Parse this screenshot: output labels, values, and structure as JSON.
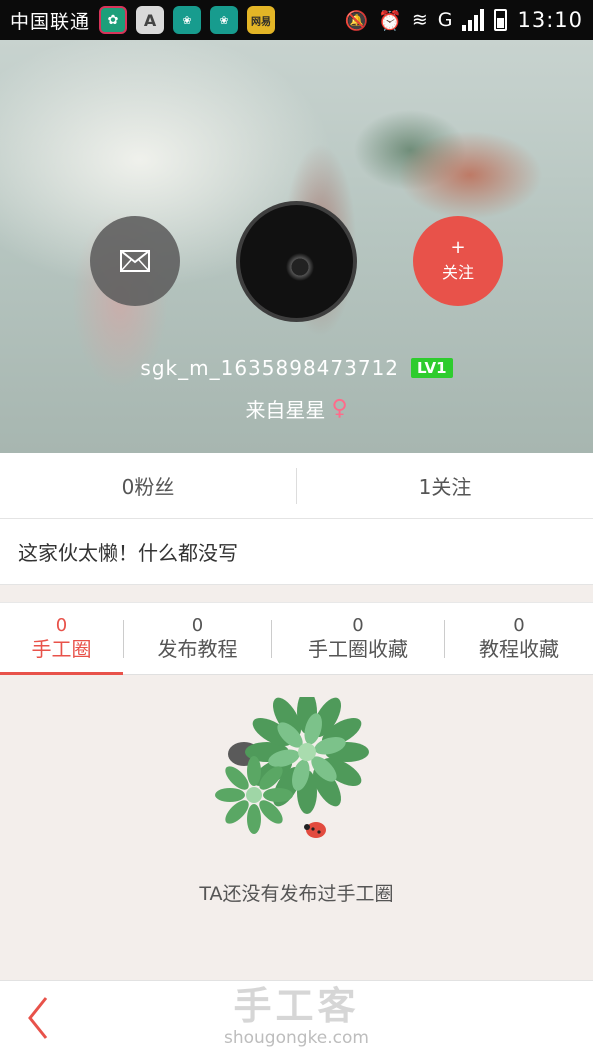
{
  "status_bar": {
    "carrier": "中国联通",
    "apps": [
      "A",
      "",
      "",
      "网易"
    ],
    "network": "G",
    "time": "13:10"
  },
  "profile": {
    "username": "sgk_m_1635898473712",
    "level": "LV1",
    "location": "来自星星",
    "gender_symbol": "♀"
  },
  "actions": {
    "message_icon": "envelope-icon",
    "follow_plus": "+",
    "follow_label": "关注"
  },
  "stats": {
    "fans": "0粉丝",
    "following": "1关注"
  },
  "bio": "这家伙太懒！什么都没写",
  "tabs": [
    {
      "count": "0",
      "label": "手工圈",
      "active": true
    },
    {
      "count": "0",
      "label": "发布教程",
      "active": false
    },
    {
      "count": "0",
      "label": "手工圈收藏",
      "active": false
    },
    {
      "count": "0",
      "label": "教程收藏",
      "active": false
    }
  ],
  "empty_state": {
    "message": "TA还没有发布过手工圈"
  },
  "bottom_bar": {
    "brand_cn": "手工客",
    "brand_url": "shougongke.com"
  },
  "colors": {
    "accent": "#e8524a",
    "level_badge": "#2ecc2e",
    "gender": "#ff6b8a"
  }
}
